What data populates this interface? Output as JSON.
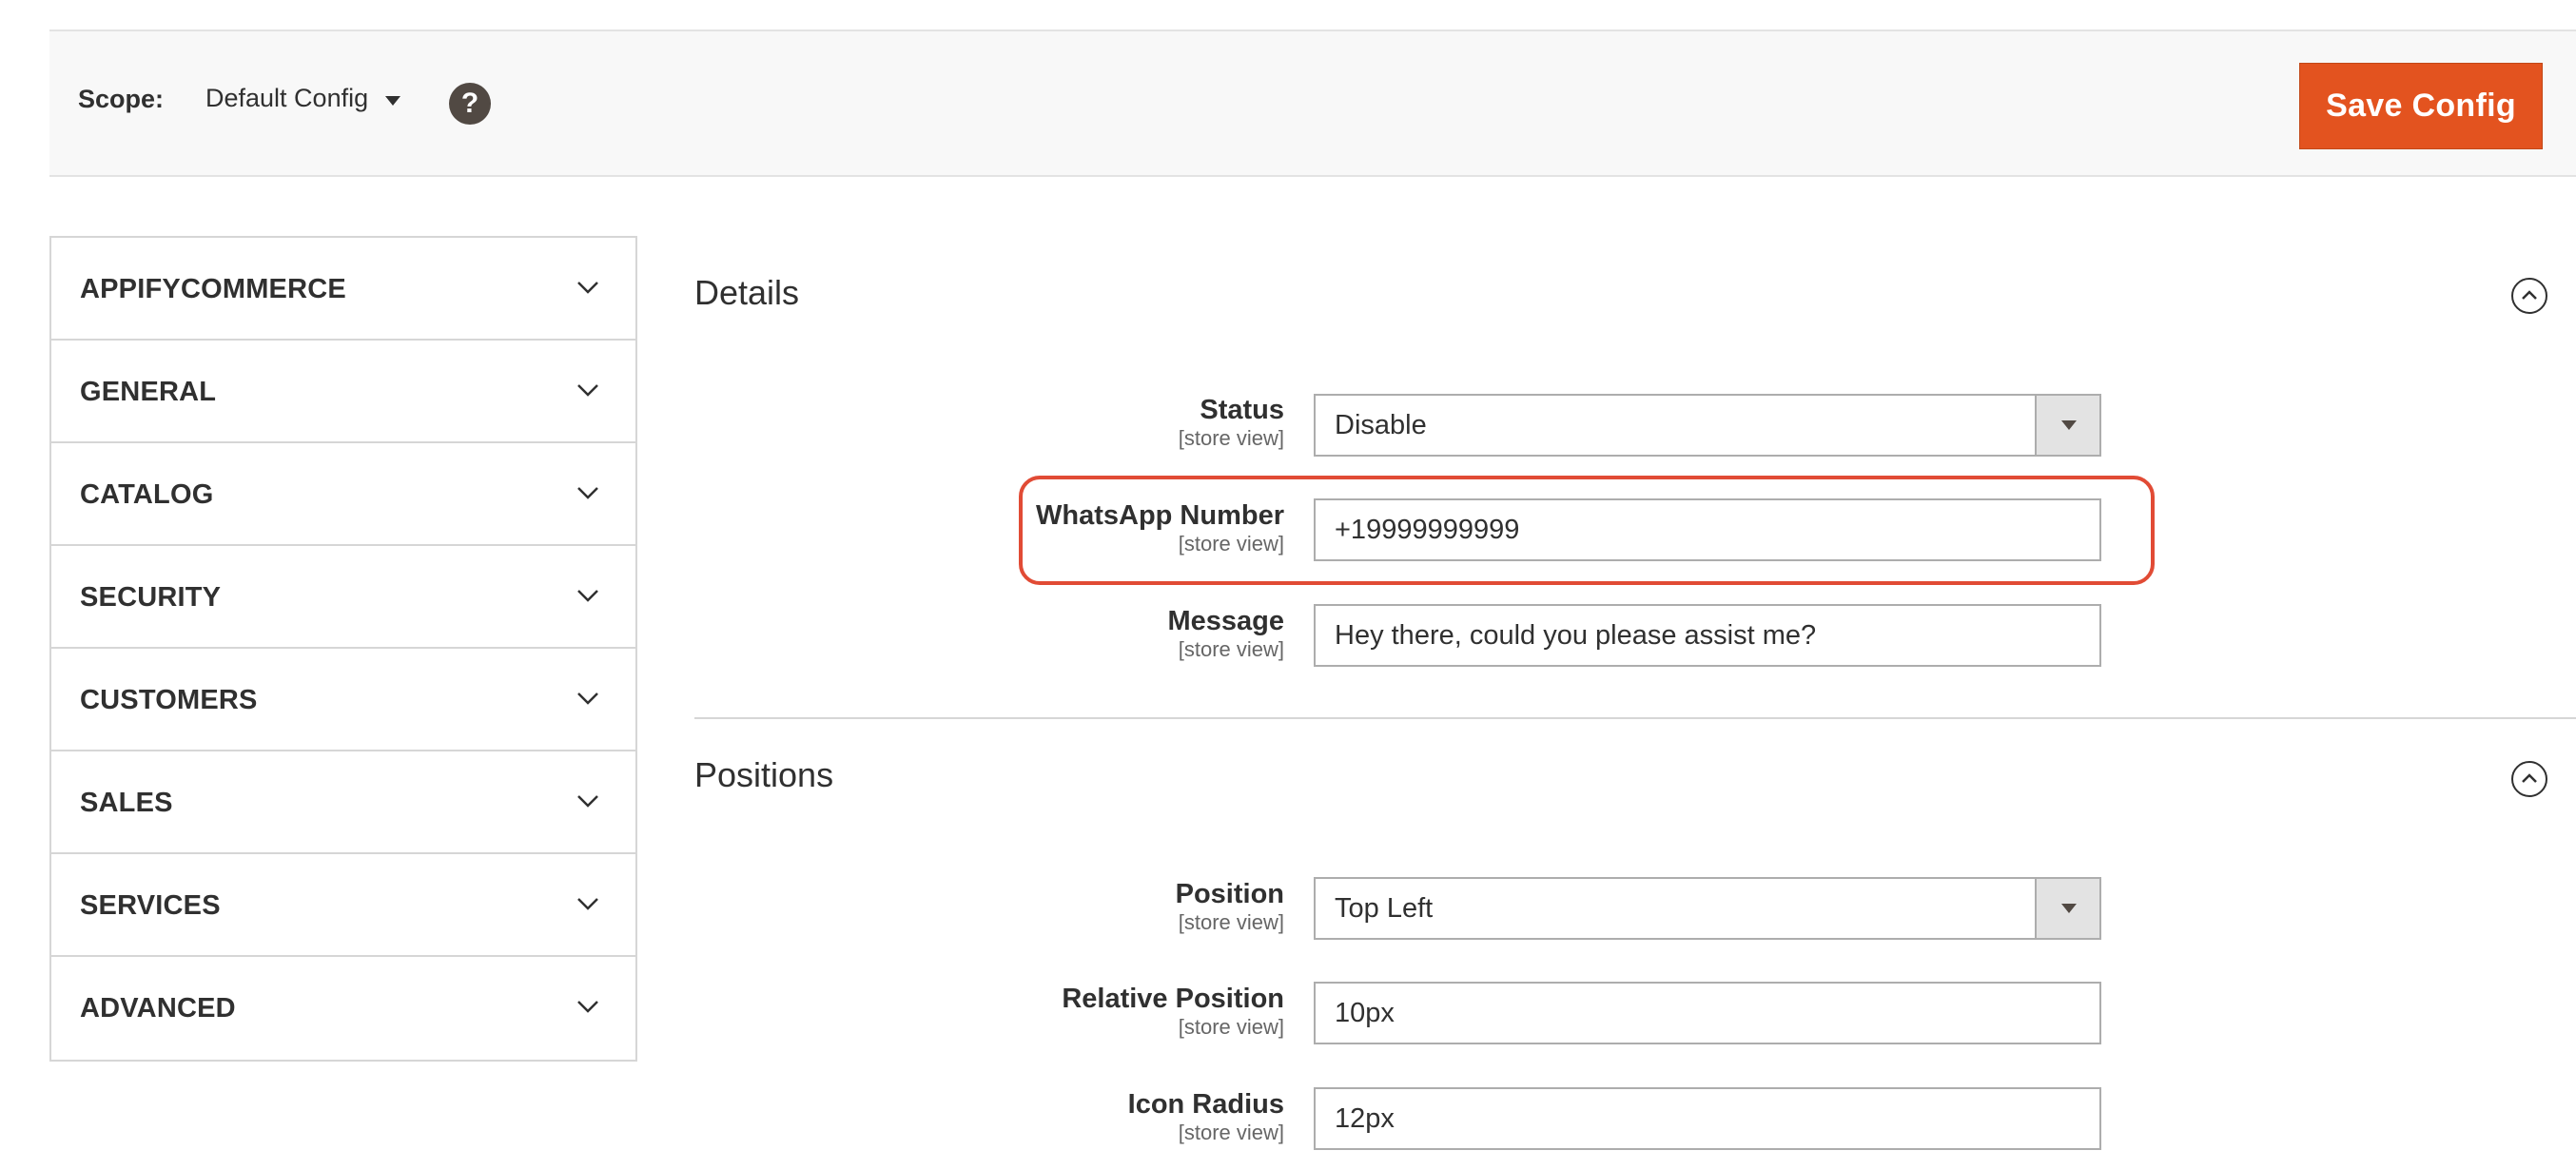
{
  "scope_bar": {
    "label": "Scope:",
    "current_scope": "Default Config",
    "help_glyph": "?",
    "save_label": "Save Config",
    "save_color": "#e3531f"
  },
  "sidebar": {
    "items": [
      {
        "label": "APPIFYCOMMERCE"
      },
      {
        "label": "GENERAL"
      },
      {
        "label": "CATALOG"
      },
      {
        "label": "SECURITY"
      },
      {
        "label": "CUSTOMERS"
      },
      {
        "label": "SALES"
      },
      {
        "label": "SERVICES"
      },
      {
        "label": "ADVANCED"
      }
    ]
  },
  "details": {
    "title": "Details",
    "fields": {
      "status": {
        "label": "Status",
        "scope": "[store view]",
        "value": "Disable"
      },
      "whatsapp": {
        "label": "WhatsApp Number",
        "scope": "[store view]",
        "value": "+19999999999"
      },
      "message": {
        "label": "Message",
        "scope": "[store view]",
        "value": "Hey there, could you please assist me?"
      }
    }
  },
  "positions": {
    "title": "Positions",
    "fields": {
      "position": {
        "label": "Position",
        "scope": "[store view]",
        "value": "Top Left"
      },
      "relative": {
        "label": "Relative Position",
        "scope": "[store view]",
        "value": "10px"
      },
      "radius": {
        "label": "Icon Radius",
        "scope": "[store view]",
        "value": "12px"
      }
    }
  },
  "highlight_color": "#e14b35"
}
